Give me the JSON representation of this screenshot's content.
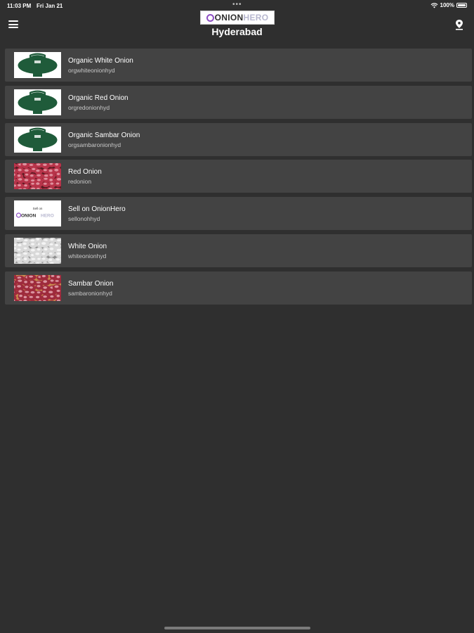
{
  "status_bar": {
    "time": "11:03 PM",
    "date": "Fri Jan 21",
    "dots": "•••",
    "battery": "100%"
  },
  "header": {
    "logo_onion": "ONION",
    "logo_hero": "HERO",
    "city": "Hyderabad"
  },
  "items": [
    {
      "title": "Organic White Onion",
      "subtitle": "orgwhiteonionhyd",
      "thumb": "organic"
    },
    {
      "title": "Organic Red Onion",
      "subtitle": "orgredonionhyd",
      "thumb": "organic"
    },
    {
      "title": "Organic Sambar Onion",
      "subtitle": "orgsambaronionhyd",
      "thumb": "organic"
    },
    {
      "title": "Red Onion",
      "subtitle": "redonion",
      "thumb": "red"
    },
    {
      "title": "Sell on OnionHero",
      "subtitle": "sellonohhyd",
      "thumb": "sell"
    },
    {
      "title": "White Onion",
      "subtitle": "whiteonionhyd",
      "thumb": "white"
    },
    {
      "title": "Sambar Onion",
      "subtitle": "sambaronionhyd",
      "thumb": "sambar"
    }
  ],
  "sell_thumb": {
    "small_text": "Sell on",
    "brand_onion": "ONION",
    "brand_hero": "HERO"
  },
  "colors": {
    "background": "#2f2f2f",
    "card": "#434343",
    "organic_green": "#1f5b3a",
    "brand_purple": "#8e4fc4"
  }
}
